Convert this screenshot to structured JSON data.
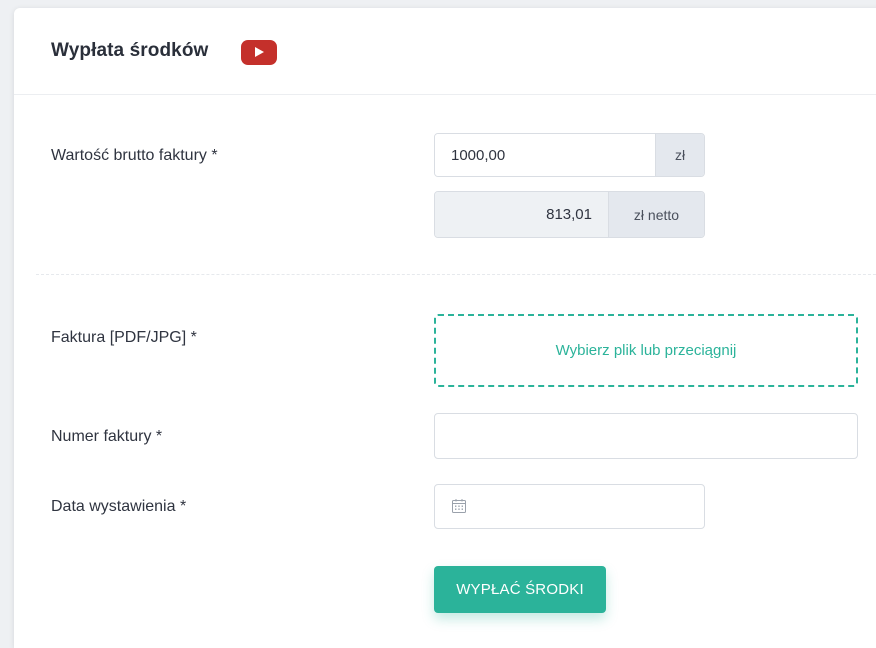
{
  "header": {
    "title": "Wypłata środków",
    "video_icon": "youtube-play-icon"
  },
  "form": {
    "gross_amount": {
      "label": "Wartość brutto faktury  *",
      "value": "1000,00",
      "unit": "zł"
    },
    "net_amount": {
      "value": "813,01",
      "unit": "zł netto"
    },
    "invoice_file": {
      "label": "Faktura [PDF/JPG] *",
      "dropzone_text": "Wybierz plik lub przeciągnij"
    },
    "invoice_number": {
      "label": "Numer faktury *",
      "value": ""
    },
    "issue_date": {
      "label": "Data wystawienia *",
      "value": "",
      "icon": "calendar-icon"
    },
    "submit_label": "WYPŁAĆ ŚRODKI"
  },
  "colors": {
    "accent": "#2bb39a",
    "youtube_red": "#c4302b",
    "addon_bg": "#e4e8ee",
    "readonly_bg": "#eef1f4"
  }
}
